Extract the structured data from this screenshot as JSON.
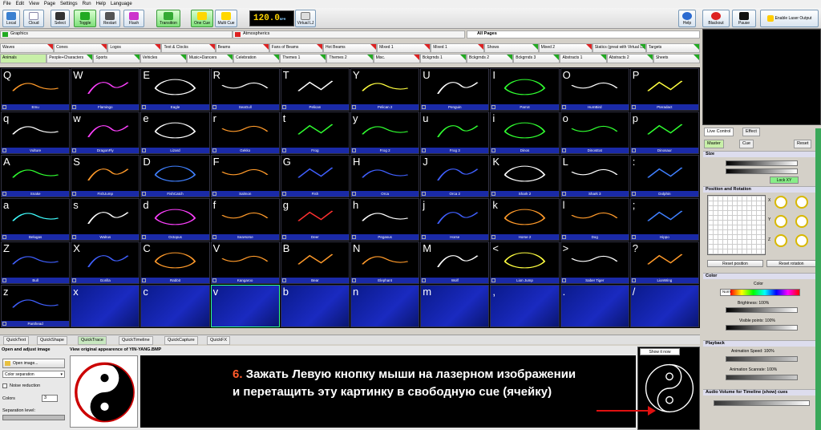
{
  "menu": [
    "File",
    "Edit",
    "View",
    "Page",
    "Settings",
    "Run",
    "Help",
    "Language"
  ],
  "toolbar": {
    "local": "Local",
    "cloud": "Cloud",
    "select": "Select",
    "toggle": "Toggle",
    "restart": "Restart",
    "flash": "Flash",
    "transition": "Transition",
    "one_cue": "One Cue",
    "multi_cue": "Multi Cue",
    "bpm": "120.0",
    "bpm_unit": "BPM",
    "virtual_lj": "Virtual LJ",
    "help": "Help",
    "blackout": "Blackout",
    "pause": "Pause",
    "enable_output": "Enable Laser Output"
  },
  "pages": {
    "graphics": "Graphics",
    "atmospherics": "Atmospherics",
    "all_pages": "All Pages"
  },
  "categories_row1": [
    {
      "label": "Waves",
      "flag": "r"
    },
    {
      "label": "Cones",
      "flag": "r"
    },
    {
      "label": "Logos",
      "flag": "r"
    },
    {
      "label": "Text & Clocks",
      "flag": "r"
    },
    {
      "label": "Beams",
      "flag": "r"
    },
    {
      "label": "Fans of Beams",
      "flag": "r"
    },
    {
      "label": "Hot Beams",
      "flag": "r"
    },
    {
      "label": "Mixed 1",
      "flag": "r"
    },
    {
      "label": "Mixed 1",
      "flag": "r"
    },
    {
      "label": "Shows",
      "flag": "g"
    },
    {
      "label": "Mixed 2",
      "flag": "r"
    },
    {
      "label": "Statics (great with Virtual LJ)",
      "flag": "g"
    },
    {
      "label": "Targets",
      "flag": "g"
    }
  ],
  "categories_row2": [
    {
      "label": "Animals",
      "flag": "",
      "sel": true
    },
    {
      "label": "People+Characters",
      "flag": "g"
    },
    {
      "label": "Sports",
      "flag": "g"
    },
    {
      "label": "Vehicles",
      "flag": "g"
    },
    {
      "label": "Music+Dancers",
      "flag": "g"
    },
    {
      "label": "Celebration",
      "flag": "g"
    },
    {
      "label": "Themes 1",
      "flag": "g"
    },
    {
      "label": "Themes 2",
      "flag": "g"
    },
    {
      "label": "Misc.",
      "flag": "r"
    },
    {
      "label": "Bckgrnds 1",
      "flag": "g"
    },
    {
      "label": "Bckgrnds 2",
      "flag": "g"
    },
    {
      "label": "Bckgrnds 3",
      "flag": "g"
    },
    {
      "label": "Abstracts 1",
      "flag": "g"
    },
    {
      "label": "Abstracts 2",
      "flag": "g"
    },
    {
      "label": "Sheets",
      "flag": "g"
    }
  ],
  "cells": [
    {
      "key": "Q",
      "label": "Emu",
      "c": "#ff9a2a"
    },
    {
      "key": "W",
      "label": "Flamingo",
      "c": "#ff40ff"
    },
    {
      "key": "E",
      "label": "Eagle",
      "c": "#ffffff"
    },
    {
      "key": "R",
      "label": "SeaGull",
      "c": "#ffffff"
    },
    {
      "key": "T",
      "label": "Pelican",
      "c": "#ffffff"
    },
    {
      "key": "Y",
      "label": "Pelican 2",
      "c": "#ffff40"
    },
    {
      "key": "U",
      "label": "Penguin",
      "c": "#ffffff"
    },
    {
      "key": "I",
      "label": "Parrot",
      "c": "#30ff30"
    },
    {
      "key": "O",
      "label": "HumBird",
      "c": "#ffffff"
    },
    {
      "key": "P",
      "label": "Pteradact",
      "c": "#ffff40"
    },
    {
      "key": "q",
      "label": "Vulture",
      "c": "#ffffff"
    },
    {
      "key": "w",
      "label": "DragonFly",
      "c": "#ff40ff"
    },
    {
      "key": "e",
      "label": "Lizard",
      "c": "#ffffff"
    },
    {
      "key": "r",
      "label": "Gekko",
      "c": "#ff9a2a"
    },
    {
      "key": "t",
      "label": "Frog",
      "c": "#30ff30"
    },
    {
      "key": "y",
      "label": "Frog 2",
      "c": "#30ff30"
    },
    {
      "key": "u",
      "label": "Frog 3",
      "c": "#30ff30"
    },
    {
      "key": "i",
      "label": "Dinos",
      "c": "#30ff30"
    },
    {
      "key": "o",
      "label": "DinosEat",
      "c": "#30ff30"
    },
    {
      "key": "p",
      "label": "Dinosaur",
      "c": "#30ff30"
    },
    {
      "key": "A",
      "label": "Snake",
      "c": "#30ff30"
    },
    {
      "key": "S",
      "label": "FishJump",
      "c": "#ff9a2a"
    },
    {
      "key": "D",
      "label": "FishCatch",
      "c": "#4080ff"
    },
    {
      "key": "F",
      "label": "Salmon",
      "c": "#ff9a2a"
    },
    {
      "key": "G",
      "label": "Fish",
      "c": "#4060ff"
    },
    {
      "key": "H",
      "label": "Orca",
      "c": "#4060ff"
    },
    {
      "key": "J",
      "label": "Orca 2",
      "c": "#4060ff"
    },
    {
      "key": "K",
      "label": "Shark 2",
      "c": "#ffffff"
    },
    {
      "key": "L",
      "label": "Shark 3",
      "c": "#ffffff"
    },
    {
      "key": ":",
      "label": "Dolphin",
      "c": "#4080ff"
    },
    {
      "key": "a",
      "label": "Belugas",
      "c": "#40ffff"
    },
    {
      "key": "s",
      "label": "Walrus",
      "c": "#ffffff"
    },
    {
      "key": "d",
      "label": "Octopus",
      "c": "#ff40ff"
    },
    {
      "key": "f",
      "label": "SeaHorse",
      "c": "#ff9a2a"
    },
    {
      "key": "g",
      "label": "Deer",
      "c": "#ff3030"
    },
    {
      "key": "h",
      "label": "Pegasus",
      "c": "#ffffff"
    },
    {
      "key": "j",
      "label": "Horse",
      "c": "#4060ff"
    },
    {
      "key": "k",
      "label": "Horse 2",
      "c": "#ff9a2a"
    },
    {
      "key": "l",
      "label": "Dog",
      "c": "#ff9a2a"
    },
    {
      "key": ";",
      "label": "Hippo",
      "c": "#4080ff"
    },
    {
      "key": "Z",
      "label": "Bull",
      "c": "#4060ff"
    },
    {
      "key": "X",
      "label": "Gorilla",
      "c": "#4060ff"
    },
    {
      "key": "C",
      "label": "Rabbit",
      "c": "#ff9a2a"
    },
    {
      "key": "V",
      "label": "Kangaroo",
      "c": "#ff9a2a"
    },
    {
      "key": "B",
      "label": "Bear",
      "c": "#ff9a2a"
    },
    {
      "key": "N",
      "label": "Elephant",
      "c": "#ff9a2a"
    },
    {
      "key": "M",
      "label": "Wolf",
      "c": "#ffffff"
    },
    {
      "key": "<",
      "label": "Lion Jump",
      "c": "#ffff40"
    },
    {
      "key": ">",
      "label": "Saber Tiger",
      "c": "#ffffff"
    },
    {
      "key": "?",
      "label": "LionWing",
      "c": "#ff9a2a"
    },
    {
      "key": "z",
      "label": "Panthead",
      "c": "#4060ff"
    },
    {
      "key": "x",
      "label": "",
      "c": ""
    },
    {
      "key": "c",
      "label": "",
      "c": ""
    },
    {
      "key": "v",
      "label": "",
      "c": "",
      "hl": true
    },
    {
      "key": "b",
      "label": "",
      "c": ""
    },
    {
      "key": "n",
      "label": "",
      "c": ""
    },
    {
      "key": "m",
      "label": "",
      "c": ""
    },
    {
      "key": ",",
      "label": "",
      "c": ""
    },
    {
      "key": ".",
      "label": "",
      "c": ""
    },
    {
      "key": "/",
      "label": "",
      "c": ""
    }
  ],
  "right": {
    "tab_live": "Live Control",
    "tab_effect": "Effect",
    "tab_master": "Master",
    "tab_cue": "Cue",
    "reset": "Reset",
    "size": "Size",
    "lock_xy": "Lock XY",
    "position_rotation": "Position and Rotation",
    "reset_position": "Reset position",
    "reset_rotation": "Reset rotation",
    "color": "Color",
    "color_label": "Color",
    "norm": "Norm",
    "brightness": "Brightness: 100%",
    "visible_points": "Visible points: 100%",
    "playback": "Playback",
    "anim_speed": "Animation Speed: 100%",
    "anim_scanrate": "Animation Scanrate: 100%",
    "audio_volume": "Audio Volume for Timeline (show) cues",
    "axis_x": "X",
    "axis_y": "Y",
    "axis_z": "Z"
  },
  "bottom_tabs": [
    "QuickText",
    "QuickShape",
    "QuickTrace",
    "QuickTimeline",
    "QuickCapture",
    "QuickFX"
  ],
  "trace": {
    "open_adjust": "Open and adjust image",
    "view_original": "View original appearence of YIN-YANG.BMP",
    "open_image": "Open image...",
    "color_separation": "Color separation",
    "noise_reduction": "Noise reduction",
    "colors_label": "Colors",
    "colors_value": "3",
    "separation_level": "Separation level:",
    "show_it_now": "Show it now"
  },
  "instruction": {
    "num": "6.",
    "line1": "Зажать Левую кнопку мыши на лазерном изображении",
    "line2": "и перетащить эту картинку в свободную cue (ячейку)"
  },
  "colors": {
    "accent_green": "#c8f0a8",
    "cell_label_bg": "#1a2aa8",
    "instruction_number": "#ff5a2a",
    "arrow": "#e01010"
  }
}
